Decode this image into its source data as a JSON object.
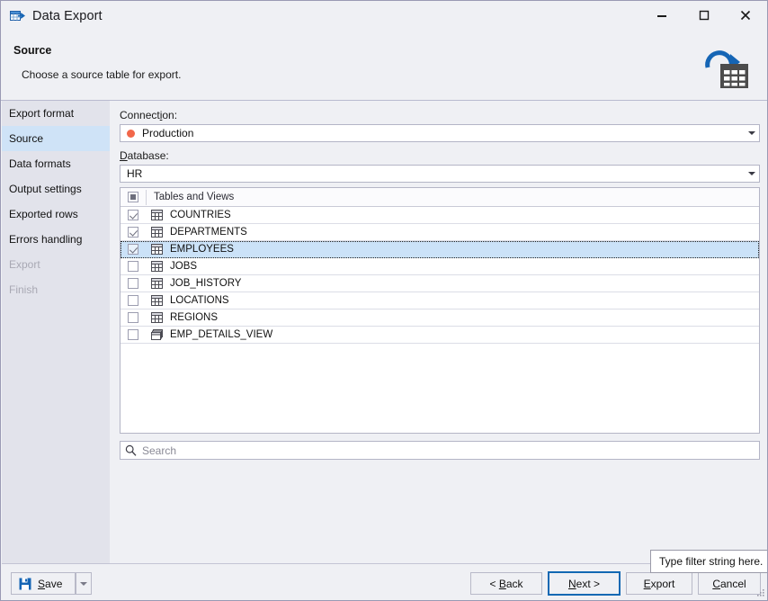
{
  "window": {
    "title": "Data Export",
    "app_icon": "table-export-icon",
    "minimize_label": "Minimize",
    "maximize_label": "Maximize",
    "close_label": "Close"
  },
  "header": {
    "title": "Source",
    "subtitle": "Choose a source table for export.",
    "icon": "export-table-icon"
  },
  "sidebar": {
    "items": [
      {
        "label": "Export format",
        "state": "normal"
      },
      {
        "label": "Source",
        "state": "active"
      },
      {
        "label": "Data formats",
        "state": "normal"
      },
      {
        "label": "Output settings",
        "state": "normal"
      },
      {
        "label": "Exported rows",
        "state": "normal"
      },
      {
        "label": "Errors handling",
        "state": "normal"
      },
      {
        "label": "Export",
        "state": "disabled"
      },
      {
        "label": "Finish",
        "state": "disabled"
      }
    ]
  },
  "main": {
    "connection": {
      "label_pre": "Connect",
      "label_acc": "i",
      "label_post": "on:",
      "value": "Production",
      "dot_color": "#f2674a",
      "dropdown_icon": "chevron-down-icon"
    },
    "database": {
      "label_acc": "D",
      "label_post": "atabase:",
      "value": "HR",
      "dropdown_icon": "chevron-down-icon"
    },
    "list": {
      "header_label": "Tables and Views",
      "header_checkbox_state": "indeterminate",
      "rows": [
        {
          "name": "COUNTRIES",
          "checked": true,
          "icon": "table-icon",
          "selected": false
        },
        {
          "name": "DEPARTMENTS",
          "checked": true,
          "icon": "table-icon",
          "selected": false
        },
        {
          "name": "EMPLOYEES",
          "checked": true,
          "icon": "table-icon",
          "selected": true
        },
        {
          "name": "JOBS",
          "checked": false,
          "icon": "table-icon",
          "selected": false
        },
        {
          "name": "JOB_HISTORY",
          "checked": false,
          "icon": "table-icon",
          "selected": false
        },
        {
          "name": "LOCATIONS",
          "checked": false,
          "icon": "table-icon",
          "selected": false
        },
        {
          "name": "REGIONS",
          "checked": false,
          "icon": "table-icon",
          "selected": false
        },
        {
          "name": "EMP_DETAILS_VIEW",
          "checked": false,
          "icon": "view-icon",
          "selected": false
        }
      ]
    },
    "search": {
      "placeholder": "Search",
      "icon": "search-icon"
    },
    "tooltip": {
      "text": "Type filter string here."
    }
  },
  "footer": {
    "save": {
      "label_acc": "S",
      "label_post": "ave",
      "icon": "save-floppy-icon"
    },
    "save_dropdown_icon": "chevron-down-icon",
    "back": {
      "pre": "< ",
      "acc": "B",
      "post": "ack"
    },
    "next": {
      "acc": "N",
      "post": "ext >",
      "default": true
    },
    "export": {
      "acc": "E",
      "post": "xport"
    },
    "cancel": {
      "acc": "C",
      "post": "ancel"
    }
  },
  "colors": {
    "accent": "#1268b3",
    "selection": "#cbe2f8",
    "sidebar_active": "#cfe3f7",
    "connection_dot": "#f2674a",
    "window_bg": "#eff0f4"
  }
}
